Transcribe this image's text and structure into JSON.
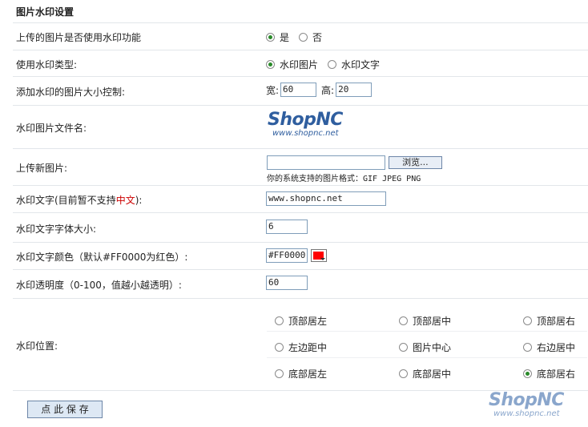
{
  "section_title": "图片水印设置",
  "rows": {
    "enable": {
      "label": "上传的图片是否使用水印功能",
      "yes": "是",
      "no": "否"
    },
    "type": {
      "label": "使用水印类型:",
      "image": "水印图片",
      "text": "水印文字"
    },
    "size": {
      "label": "添加水印的图片大小控制:",
      "width_label": "宽:",
      "width_value": "60",
      "height_label": "高:",
      "height_value": "20"
    },
    "file": {
      "label": "水印图片文件名:",
      "logo_main": "ShopNC",
      "logo_url": "www.shopnc.net"
    },
    "upload": {
      "label": "上传新图片:",
      "browse": "浏览...",
      "formats": "你的系统支持的图片格式：GIF JPEG PNG"
    },
    "wm_text": {
      "label_prefix": "水印文字(目前暂不支持",
      "label_red": "中文",
      "label_suffix": "):",
      "value": "www.shopnc.net"
    },
    "font_size": {
      "label": "水印文字字体大小:",
      "value": "6"
    },
    "color": {
      "label": "水印文字颜色（默认#FF0000为红色）:",
      "value": "#FF0000",
      "swatch": "#ff0000"
    },
    "opacity": {
      "label": "水印透明度（0-100，值越小越透明）:",
      "value": "60"
    },
    "position": {
      "label": "水印位置:",
      "options": [
        "顶部居左",
        "顶部居中",
        "顶部居右",
        "左边距中",
        "图片中心",
        "右边居中",
        "底部居左",
        "底部居中",
        "底部居右"
      ],
      "selected_index": 8
    }
  },
  "footer": {
    "save": "点 此 保 存",
    "logo_main": "ShopNC",
    "logo_url": "www.shopnc.net"
  }
}
